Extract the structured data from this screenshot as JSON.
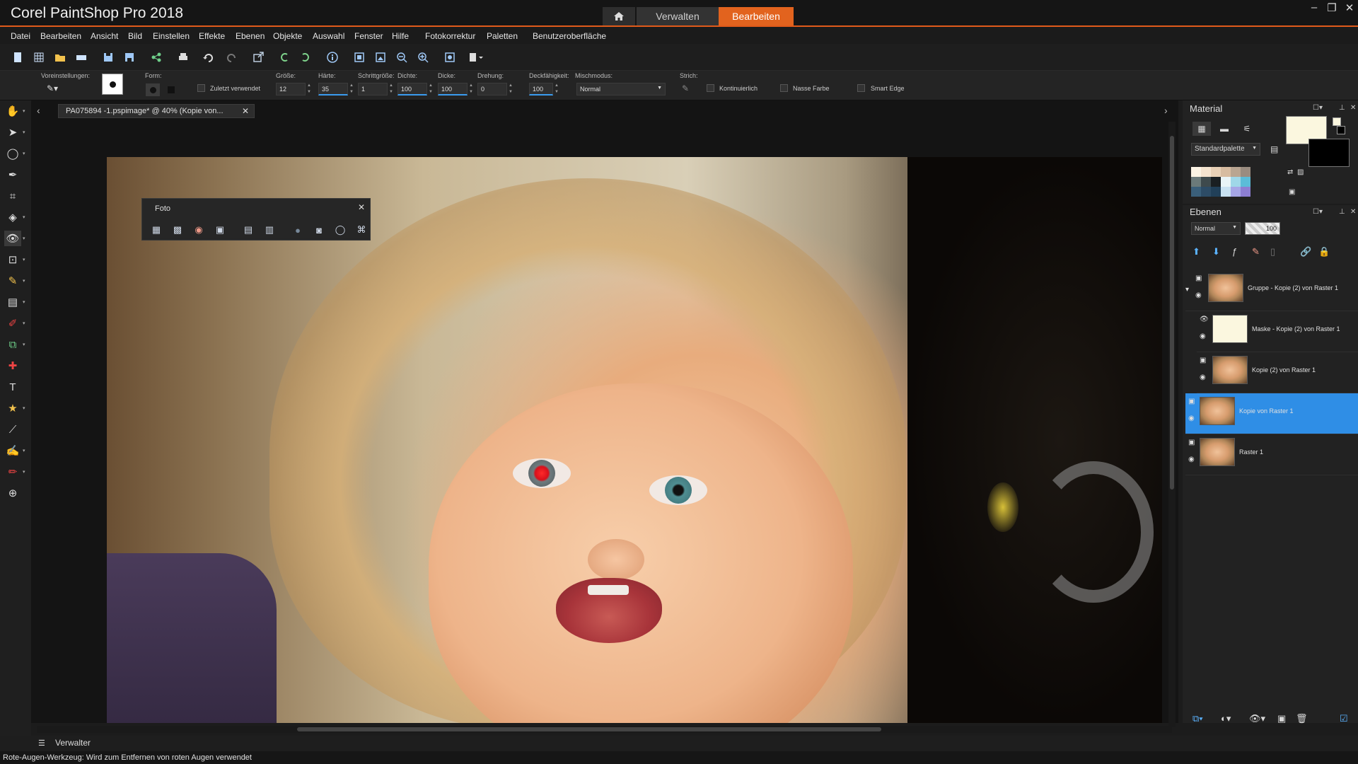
{
  "app": {
    "title": "Corel PaintShop Pro 2018"
  },
  "workspace_tabs": {
    "manage": "Verwalten",
    "edit": "Bearbeiten"
  },
  "menu": [
    "Datei",
    "Bearbeiten",
    "Ansicht",
    "Bild",
    "Einstellen",
    "Effekte",
    "Ebenen",
    "Objekte",
    "Auswahl",
    "Fenster",
    "Hilfe",
    "Fotokorrektur",
    "Paletten",
    "Benutzeroberfläche"
  ],
  "tool_options": {
    "presets_label": "Voreinstellungen:",
    "form_label": "Form:",
    "recent_label": "Zuletzt verwendet",
    "size_label": "Größe:",
    "size_value": "12",
    "hardness_label": "Härte:",
    "hardness_value": "35",
    "step_label": "Schrittgröße:",
    "step_value": "1",
    "density_label": "Dichte:",
    "density_value": "100",
    "thickness_label": "Dicke:",
    "thickness_value": "100",
    "rotation_label": "Drehung:",
    "rotation_value": "0",
    "opacity_label": "Deckfähigkeit:",
    "opacity_value": "100",
    "blend_label": "Mischmodus:",
    "blend_value": "Normal",
    "stroke_label": "Strich:",
    "continuous_label": "Kontinuierlich",
    "wet_label": "Nasse Farbe",
    "smartedge_label": "Smart Edge"
  },
  "document": {
    "tab_title": "PA075894 -1.pspimage* @  40% (Kopie von..."
  },
  "foto_palette": {
    "title": "Foto"
  },
  "material": {
    "title": "Material",
    "palette_select": "Standardpalette"
  },
  "layers": {
    "title": "Ebenen",
    "blend_mode": "Normal",
    "opacity": "100",
    "items": [
      {
        "name": "Gruppe - Kopie (2) von Raster 1"
      },
      {
        "name": "Maske - Kopie (2) von Raster 1"
      },
      {
        "name": "Kopie (2) von Raster 1"
      },
      {
        "name": "Kopie von Raster 1"
      },
      {
        "name": "Raster 1"
      }
    ]
  },
  "manage_bar": {
    "label": "Verwalter"
  },
  "status": {
    "text": "Rote-Augen-Werkzeug: Wird zum Entfernen von roten Augen verwendet"
  },
  "colors": {
    "accent": "#e2631e",
    "selection": "#2f8ee6",
    "red_eye": "#d8101b"
  }
}
